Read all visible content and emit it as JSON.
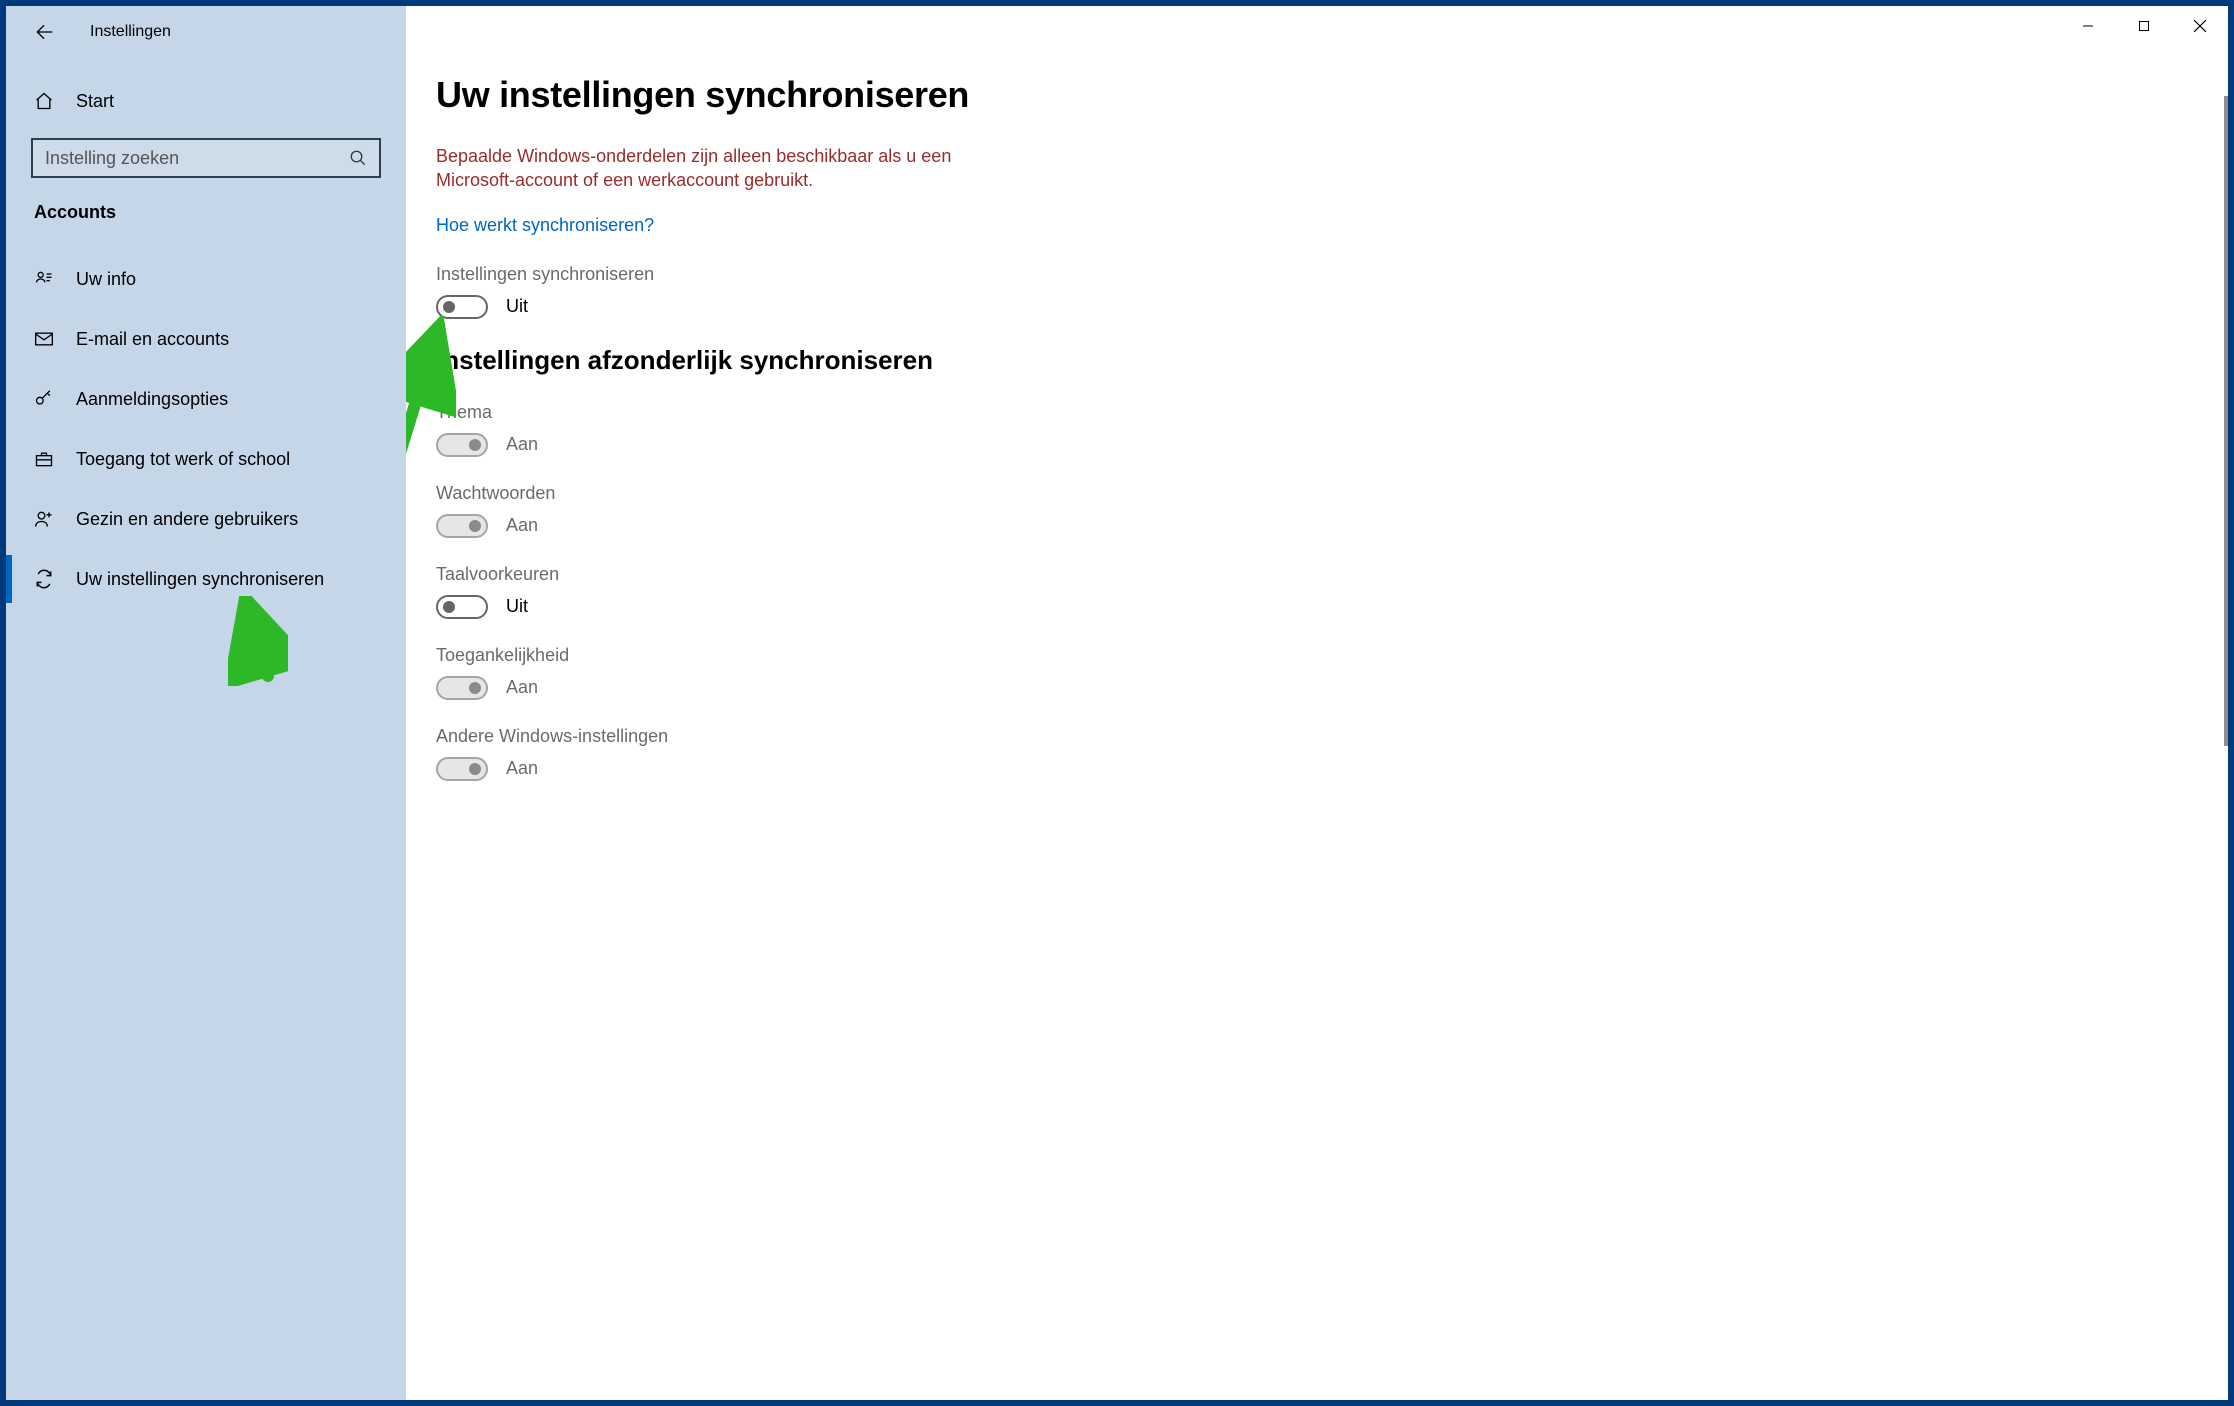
{
  "app_title": "Instellingen",
  "home_label": "Start",
  "search_placeholder": "Instelling zoeken",
  "category": "Accounts",
  "nav": [
    {
      "id": "your-info",
      "label": "Uw info",
      "icon": "person-card"
    },
    {
      "id": "email-accounts",
      "label": "E-mail en accounts",
      "icon": "mail"
    },
    {
      "id": "signin-options",
      "label": "Aanmeldingsopties",
      "icon": "key"
    },
    {
      "id": "work-school",
      "label": "Toegang tot werk of school",
      "icon": "briefcase"
    },
    {
      "id": "family-users",
      "label": "Gezin en andere gebruikers",
      "icon": "person-plus"
    },
    {
      "id": "sync-settings",
      "label": "Uw instellingen synchroniseren",
      "icon": "sync",
      "selected": true
    }
  ],
  "main": {
    "title": "Uw instellingen synchroniseren",
    "warning": "Bepaalde Windows-onderdelen zijn alleen beschikbaar als u een Microsoft-account of een werkaccount gebruikt.",
    "help_link": "Hoe werkt synchroniseren?",
    "master_toggle": {
      "label": "Instellingen synchroniseren",
      "state": "Uit",
      "on": false,
      "disabled": false
    },
    "section_title": "Instellingen afzonderlijk synchroniseren",
    "toggles": [
      {
        "id": "theme",
        "label": "Thema",
        "state": "Aan",
        "on": true,
        "disabled": true
      },
      {
        "id": "passwords",
        "label": "Wachtwoorden",
        "state": "Aan",
        "on": true,
        "disabled": true
      },
      {
        "id": "lang",
        "label": "Taalvoorkeuren",
        "state": "Uit",
        "on": false,
        "disabled": false
      },
      {
        "id": "accessibility",
        "label": "Toegankelijkheid",
        "state": "Aan",
        "on": true,
        "disabled": true
      },
      {
        "id": "other",
        "label": "Andere Windows-instellingen",
        "state": "Aan",
        "on": true,
        "disabled": true
      }
    ]
  }
}
